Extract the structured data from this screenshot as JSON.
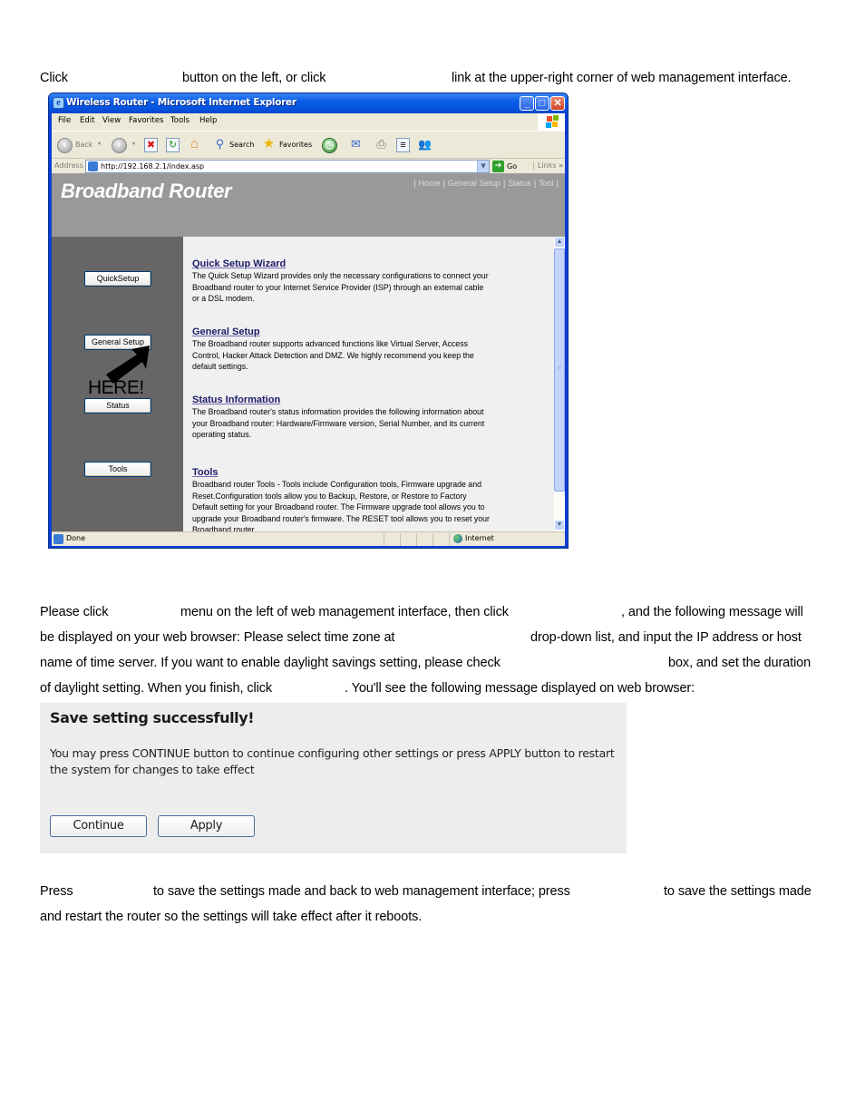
{
  "intro": {
    "line1": [
      "Click",
      "button on the left, or click",
      "link at the upper-right corner of web management interface."
    ]
  },
  "browser": {
    "window_title": "Wireless Router - Microsoft Internet Explorer",
    "window_buttons": {
      "minimize": "_",
      "maximize": "□",
      "close": "✕"
    },
    "menu": [
      "File",
      "Edit",
      "View",
      "Favorites",
      "Tools",
      "Help"
    ],
    "toolbar": {
      "back": "Back",
      "search": "Search",
      "favorites": "Favorites"
    },
    "address_label": "Address",
    "address_value": "http://192.168.2.1/index.asp",
    "go_label": "Go",
    "links_label": "Links",
    "links_chevron": "»",
    "status_text": "Done",
    "status_zone": "Internet",
    "page": {
      "brand": "Broadband Router",
      "topnav": [
        "Home",
        "General Setup",
        "Status",
        "Tool"
      ],
      "left_buttons": [
        "QuickSetup",
        "General Setup",
        "Status",
        "Tools"
      ],
      "annotation": "HERE!",
      "sections": [
        {
          "title": "Quick Setup Wizard",
          "desc": "The Quick Setup Wizard provides only the necessary configurations to connect your Broadband router to your Internet Service Provider (ISP) through an external cable or a DSL modem."
        },
        {
          "title": "General Setup",
          "desc": "The Broadband router supports advanced functions like Virtual Server, Access Control, Hacker Attack Detection and DMZ. We highly recommend you keep the default settings."
        },
        {
          "title": "Status Information",
          "desc": "The Broadband router's status information provides the following information about your Broadband router: Hardware/Firmware version, Serial Number, and its current operating status."
        },
        {
          "title": "Tools",
          "desc": "Broadband router Tools - Tools include Configuration tools, Firmware upgrade and Reset.Configuration tools allow you to Backup, Restore, or Restore to Factory Default setting for your Broadband router. The Firmware upgrade tool allows you to upgrade your Broadband router's firmware. The RESET tool allows you to reset your Broadband router."
        }
      ]
    }
  },
  "instructions": {
    "line1": [
      "Please click",
      "menu on the left of web management interface, then click",
      ", and the following message will"
    ],
    "line2": [
      "be displayed on your web browser: Please select time zone at",
      "drop-down list, and input the IP address or host"
    ],
    "line3": [
      "name of time server. If you want to enable daylight savings setting, please check",
      "box, and set the duration"
    ],
    "line4": [
      "of daylight setting. When you finish, click",
      ". You'll see the following message displayed on web browser:"
    ]
  },
  "save_dialog": {
    "title": "Save setting successfully!",
    "message": "You may press CONTINUE button to continue configuring other settings or press APPLY button to restart the system for changes to take effect",
    "continue_label": "Continue",
    "apply_label": "Apply"
  },
  "footer": {
    "line1": [
      "Press",
      "to save the settings made and back to web management interface; press",
      "to save the settings made"
    ],
    "line2": "and restart the router so the settings will take effect after it reboots."
  }
}
